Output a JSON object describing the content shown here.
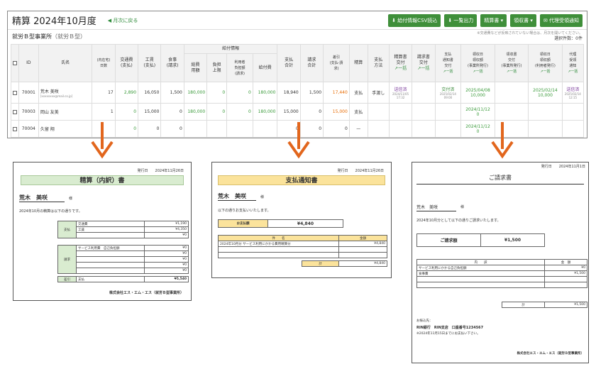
{
  "header": {
    "title": "精算 2024年10月度",
    "back_link": "月次に戻る",
    "buttons": [
      "給付情報CSV読込",
      "一覧出力",
      "精算書",
      "領収書",
      "代理受領通知"
    ]
  },
  "office": {
    "name": "就労Ｂ型事業所",
    "type": "（就労Ｂ型）"
  },
  "notes": {
    "line1": "※交通費などが反映されていない場合は、月次を開いてください。",
    "count_label": "選択件数：0件"
  },
  "table": {
    "headers": {
      "id": "ID",
      "name": "氏名",
      "days": "(内在宅)\n日数",
      "transport": "交通費\n(支払)",
      "wage": "工賃\n(支払)",
      "meal": "食事\n(請求)",
      "kyufu_group": "給付情報",
      "sohi": "総費\n用額",
      "futan": "負担\n上限",
      "riyousha": "利用者\n負担額\n(請求)",
      "kyufuhi": "給付費",
      "shiharai_total": "支払\n合計",
      "seikyu_total": "請求\n合計",
      "sahiki": "差引\n(支払-請\n求)",
      "seisan": "精算",
      "method": "支払\n方法",
      "seisansho": "精算書\n交付",
      "seikyusho": "請求書\n交付",
      "tsuchi": "支払\n通知書\n交付",
      "ryoshu_jigyo": "領収日\n領収額\n(事業所発行)",
      "ryoshu_kofu": "領収書\n交付\n(事業所発行)",
      "ryoshu_riyo": "領収日\n領収額\n(利用者発行)",
      "dairi": "代理\n受領\n通知",
      "ikkatsu": "一括"
    },
    "rows": [
      {
        "id": "70001",
        "name": "荒木 美咲",
        "email": "[xxxxxxxx@mail.co.jp]",
        "days": "17",
        "transport": "2,890",
        "wage": "16,050",
        "meal": "1,500",
        "sohi": "180,000",
        "futan": "0",
        "riyousha": "0",
        "kyufuhi": "180,000",
        "shiharai": "18,940",
        "seikyu": "1,500",
        "sahiki": "17,440",
        "seisan": "支払",
        "method": "手渡し",
        "seisansho": "送信済",
        "seisansho_date": "2024/11/05 17:32",
        "seikyusho": "",
        "tsuchi": "交付済",
        "tsuchi_date": "2025/02/14 09:00",
        "ryoshu_jigyo_date": "2025/04/08",
        "ryoshu_jigyo_amt": "10,000",
        "ryoshu_kofu": "",
        "ryoshu_riyo_date": "2025/02/14",
        "ryoshu_riyo_amt": "10,000",
        "dairi": "送信済",
        "dairi_date": "2025/02/14 12:15"
      },
      {
        "id": "70003",
        "name": "岡山 友美",
        "email": "",
        "days": "1",
        "transport": "0",
        "wage": "15,000",
        "meal": "0",
        "sohi": "180,000",
        "futan": "0",
        "riyousha": "0",
        "kyufuhi": "180,000",
        "shiharai": "15,000",
        "seikyu": "0",
        "sahiki": "15,000",
        "seisan": "支払",
        "method": "",
        "ryoshu_jigyo_date": "2024/11/12",
        "ryoshu_jigyo_amt": "0"
      },
      {
        "id": "70004",
        "name": "久留 翔",
        "email": "",
        "days": "",
        "transport": "0",
        "wage": "0",
        "meal": "0",
        "sohi": "",
        "futan": "",
        "riyousha": "",
        "kyufuhi": "",
        "shiharai": "0",
        "seikyu": "0",
        "sahiki": "0",
        "seisan": "—",
        "method": "",
        "ryoshu_jigyo_date": "2024/11/12",
        "ryoshu_jigyo_amt": "0"
      }
    ]
  },
  "doc1": {
    "issued": "発行日　　2024年11月26日",
    "title": "精算（内訳）書",
    "name": "荒木　美咲",
    "honorific": "様",
    "intro": "2024年10月の精算は以下の通りです。",
    "pay_label": "支払",
    "pay_items": [
      {
        "k": "交通費",
        "v": "¥1,190"
      },
      {
        "k": "工賃",
        "v": "¥4,350"
      },
      {
        "k": "",
        "v": "¥0"
      }
    ],
    "bill_label": "請求",
    "bill_items": [
      {
        "k": "サービス利用費　自己負担額",
        "v": "¥0"
      },
      {
        "k": "",
        "v": "¥0"
      },
      {
        "k": "",
        "v": "¥0"
      },
      {
        "k": "",
        "v": "¥0"
      },
      {
        "k": "",
        "v": "¥0"
      }
    ],
    "diff_label": "差引",
    "diff_k": "支払",
    "diff_v": "¥5,540",
    "company": "株式会社エス・エム・エス（就労Ｂ型事業所）"
  },
  "doc2": {
    "issued": "発行日　　2024年11月26日",
    "title": "支払通知書",
    "name": "荒木　美咲",
    "honorific": "様",
    "intro": "以下の通りお支払いいたします。",
    "amount_label": "お支払額",
    "amount": "¥4,840",
    "col_item": "件　　名",
    "col_amount": "金額",
    "item1": "2024年10月分 サービス利用にかかる費用精算分",
    "item1_amt": "¥4,840",
    "total_label": "計",
    "total": "¥4,840"
  },
  "doc3": {
    "issued": "発行日　　2024年11月1日",
    "title": "ご請求書",
    "name": "荒木　美咲",
    "honorific": "様",
    "intro": "2024年10月分として以下の通りご請求いたします。",
    "amount_label": "ご請求額",
    "amount": "¥1,500",
    "col_item": "内　　訳",
    "col_amount": "金　額",
    "item1": "サービス利用にかかる自己負担額",
    "item1_amt": "¥0",
    "item2": "食事費",
    "item2_amt": "¥1,500",
    "total_label": "計",
    "total": "¥1,500",
    "bank_label": "お振込先：",
    "bank": "RIN銀行　RIN支店　口座番号1234567",
    "due": "※2024年11月15日までにお支払い下さい。",
    "company": "株式会社エス・エム・エス（就労Ｂ型事業所）"
  }
}
